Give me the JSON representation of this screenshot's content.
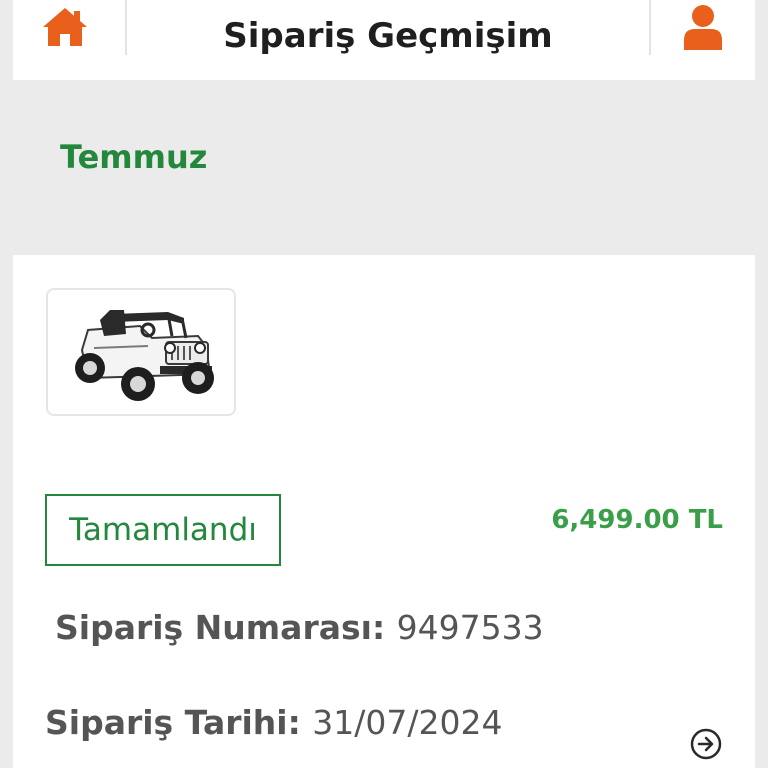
{
  "header": {
    "title": "Sipariş Geçmişim",
    "home_icon": "home-icon",
    "user_icon": "user-icon",
    "accent_color": "#e8601c"
  },
  "month": {
    "label": "Temmuz",
    "color": "#23873c"
  },
  "order": {
    "product_image": "toy-jeep-product-image",
    "status": "Tamamlandı",
    "price": "6,499.00 TL",
    "number_label": "Sipariş Numarası:",
    "number_value": "9497533",
    "date_label": "Sipariş Tarihi:",
    "date_value": "31/07/2024",
    "detail_icon": "arrow-right-circle-icon",
    "status_color": "#23873c",
    "price_color": "#3a9f48"
  }
}
